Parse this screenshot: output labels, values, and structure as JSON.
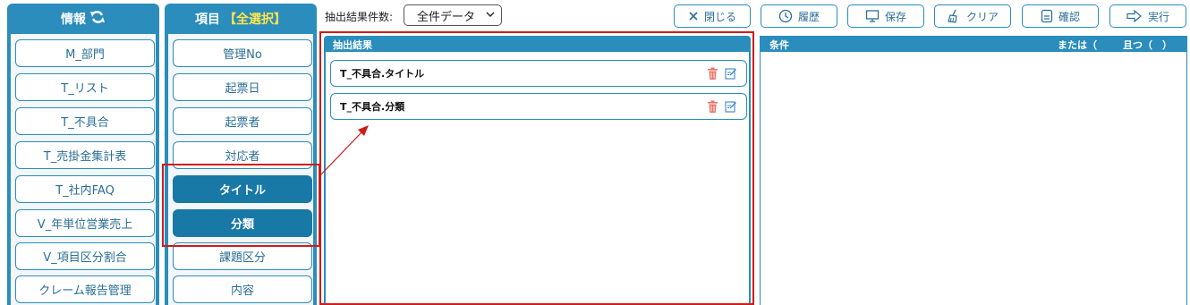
{
  "info_panel": {
    "title": "情報",
    "items": [
      "M_部門",
      "T_リスト",
      "T_不具合",
      "T_売掛金集計表",
      "T_社内FAQ",
      "V_年単位営業売上",
      "V_項目区分割合",
      "クレーム報告管理"
    ]
  },
  "item_panel": {
    "title": "項目",
    "select_all": "【全選択】",
    "items": [
      "管理No",
      "起票日",
      "起票者",
      "対応者",
      "タイトル",
      "分類",
      "課題区分",
      "内容"
    ]
  },
  "toolbar": {
    "count_label": "抽出結果件数:",
    "count_select": "全件データ",
    "buttons": {
      "close": "閉じる",
      "history": "履歴",
      "save": "保存",
      "clear": "クリア",
      "confirm": "確認",
      "execute": "実行"
    }
  },
  "results": {
    "title": "抽出結果",
    "items": [
      "T_不具合.タイトル",
      "T_不具合.分類"
    ]
  },
  "conditions": {
    "title": "条件",
    "or_label": "または（",
    "and_label": "且つ（　）"
  },
  "colors": {
    "primary": "#2a8dbb",
    "selected": "#1878a6",
    "annotation": "#d11a1a",
    "select_all": "#ffe34d"
  }
}
